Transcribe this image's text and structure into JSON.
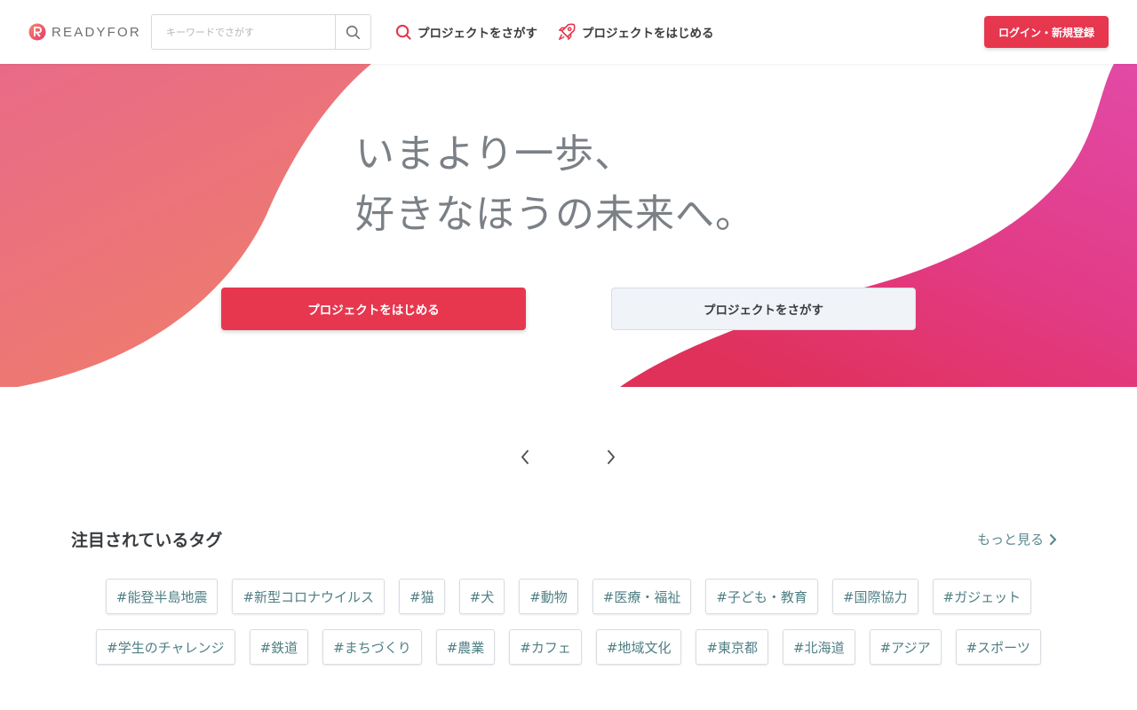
{
  "header": {
    "logo_text": "READYFOR",
    "search": {
      "placeholder": "キーワードでさがす",
      "value": ""
    },
    "nav": {
      "find_label": "プロジェクトをさがす",
      "start_label": "プロジェクトをはじめる"
    },
    "login_label": "ログイン・新規登録"
  },
  "hero": {
    "title_line1": "いまより一歩、",
    "title_line2": "好きなほうの未来へ。",
    "start_button": "プロジェクトをはじめる",
    "find_button": "プロジェクトをさがす"
  },
  "tags_section": {
    "title": "注目されているタグ",
    "more_label": "もっと見る",
    "row1": [
      "#能登半島地震",
      "#新型コロナウイルス",
      "#猫",
      "#犬",
      "#動物",
      "#医療・福祉",
      "#子ども・教育",
      "#国際協力",
      "#ガジェット"
    ],
    "row2": [
      "#学生のチャレンジ",
      "#鉄道",
      "#まちづくり",
      "#農業",
      "#カフェ",
      "#地域文化",
      "#東京都",
      "#北海道",
      "#アジア",
      "#スポーツ"
    ]
  },
  "colors": {
    "accent": "#e6374f",
    "text_dark": "#3a3d40",
    "hero_text": "#7b8086",
    "tag_text": "#4f7f84",
    "link_teal": "#5b8a8e"
  },
  "icons": {
    "search": "search-icon",
    "rocket": "rocket-icon",
    "prev": "chevron-left-icon",
    "next": "chevron-right-icon"
  }
}
